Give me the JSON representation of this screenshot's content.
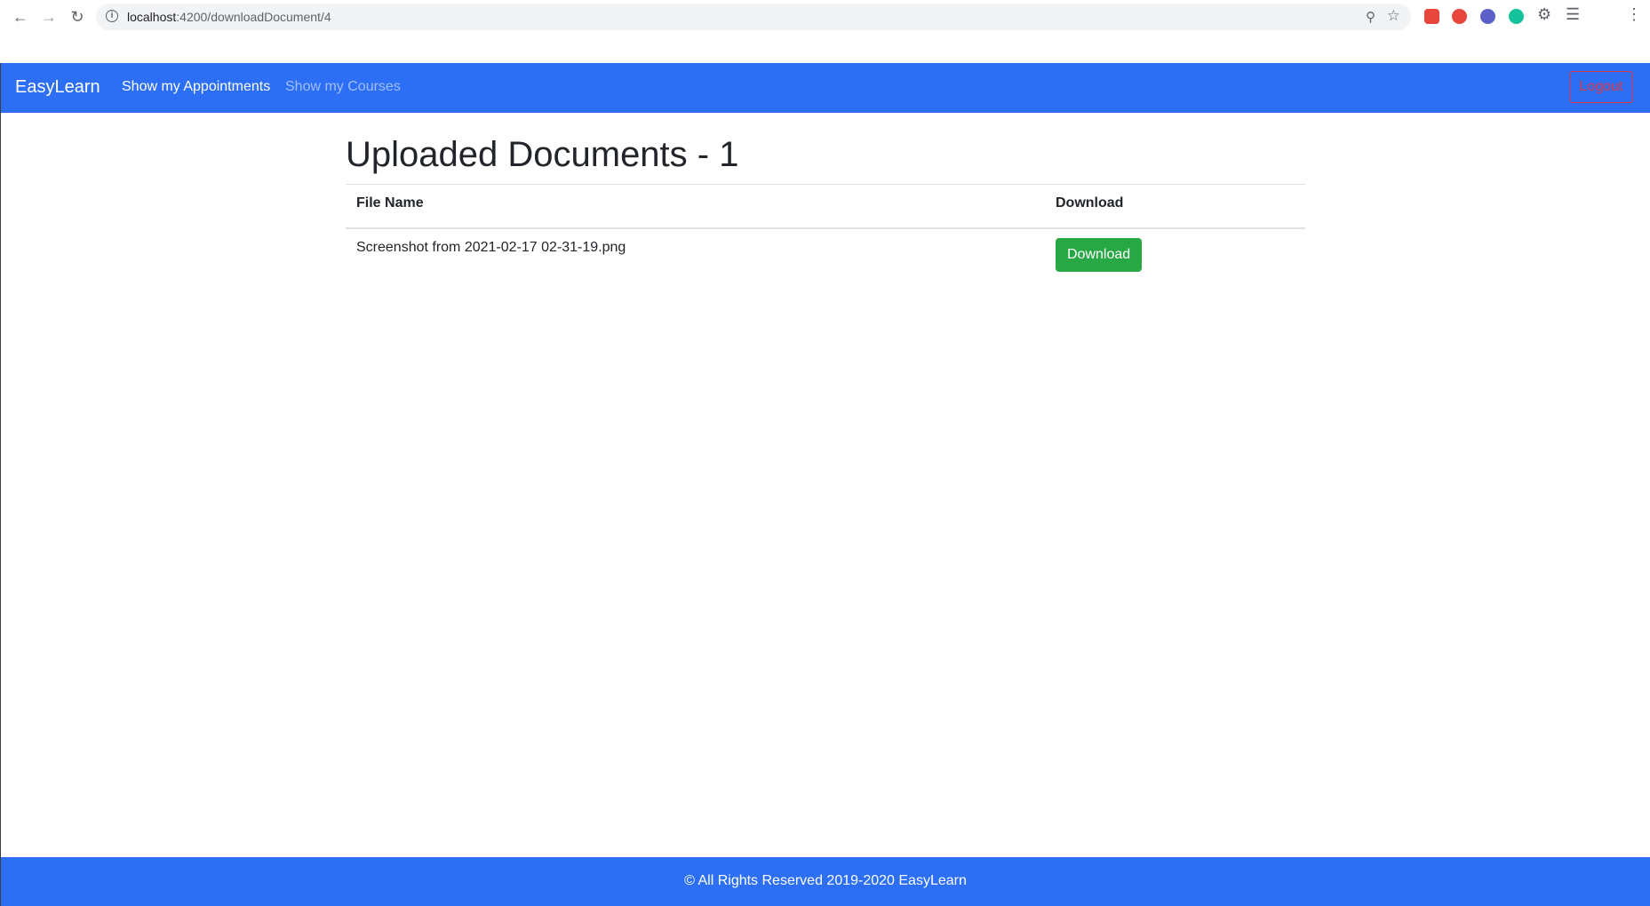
{
  "browser": {
    "url_host": "localhost",
    "url_path": ":4200/downloadDocument/4"
  },
  "navbar": {
    "brand": "EasyLearn",
    "links": [
      "Show my Appointments",
      "Show my Courses"
    ],
    "logout_label": "Logout",
    "color": "#2c6ff5"
  },
  "main": {
    "title": "Uploaded Documents - 1",
    "table": {
      "headers": [
        "File Name",
        "Download"
      ],
      "rows": [
        {
          "file_name": "Screenshot from 2021-02-17 02-31-19.png",
          "action_label": "Download"
        }
      ]
    }
  },
  "footer": {
    "text": "© All Rights Reserved 2019-2020 EasyLearn"
  },
  "colors": {
    "accent": "#2c6ff5",
    "success": "#28a745",
    "danger": "#dc3545"
  }
}
